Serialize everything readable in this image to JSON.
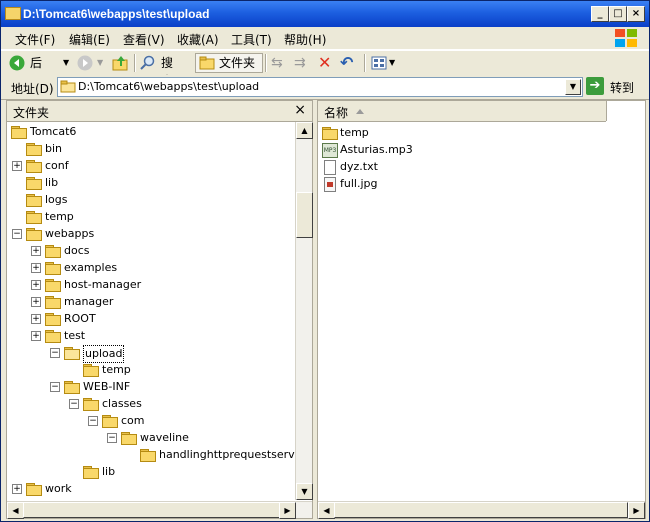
{
  "window": {
    "title": "D:\\Tomcat6\\webapps\\test\\upload"
  },
  "menu": [
    "文件(F)",
    "编辑(E)",
    "查看(V)",
    "收藏(A)",
    "工具(T)",
    "帮助(H)"
  ],
  "toolbar": {
    "back": "后退",
    "search": "搜索",
    "folders": "文件夹"
  },
  "address": {
    "label": "地址(D)",
    "value": "D:\\Tomcat6\\webapps\\test\\upload",
    "go": "转到"
  },
  "folders_pane": {
    "title": "文件夹",
    "close": "×"
  },
  "tree": [
    {
      "label": "Tomcat6",
      "expander": ""
    },
    {
      "label": "bin",
      "expander": ""
    },
    {
      "label": "conf",
      "expander": "+"
    },
    {
      "label": "lib",
      "expander": ""
    },
    {
      "label": "logs",
      "expander": ""
    },
    {
      "label": "temp",
      "expander": ""
    },
    {
      "label": "webapps",
      "expander": "−"
    },
    {
      "label": "docs",
      "expander": "+"
    },
    {
      "label": "examples",
      "expander": "+"
    },
    {
      "label": "host-manager",
      "expander": "+"
    },
    {
      "label": "manager",
      "expander": "+"
    },
    {
      "label": "ROOT",
      "expander": "+"
    },
    {
      "label": "test",
      "expander": "+"
    },
    {
      "label": "upload",
      "expander": "−"
    },
    {
      "label": "temp",
      "expander": ""
    },
    {
      "label": "WEB-INF",
      "expander": "−"
    },
    {
      "label": "classes",
      "expander": "−"
    },
    {
      "label": "com",
      "expander": "−"
    },
    {
      "label": "waveline",
      "expander": "−"
    },
    {
      "label": "handlinghttprequestservlet",
      "expander": ""
    },
    {
      "label": "lib",
      "expander": ""
    },
    {
      "label": "work",
      "expander": "+"
    }
  ],
  "files_header": {
    "name": "名称"
  },
  "files": [
    {
      "name": "temp",
      "icon": "folder-icon"
    },
    {
      "name": "Asturias.mp3",
      "icon": "mp3-file-icon"
    },
    {
      "name": "dyz.txt",
      "icon": "text-file-icon"
    },
    {
      "name": "full.jpg",
      "icon": "image-file-icon"
    }
  ]
}
